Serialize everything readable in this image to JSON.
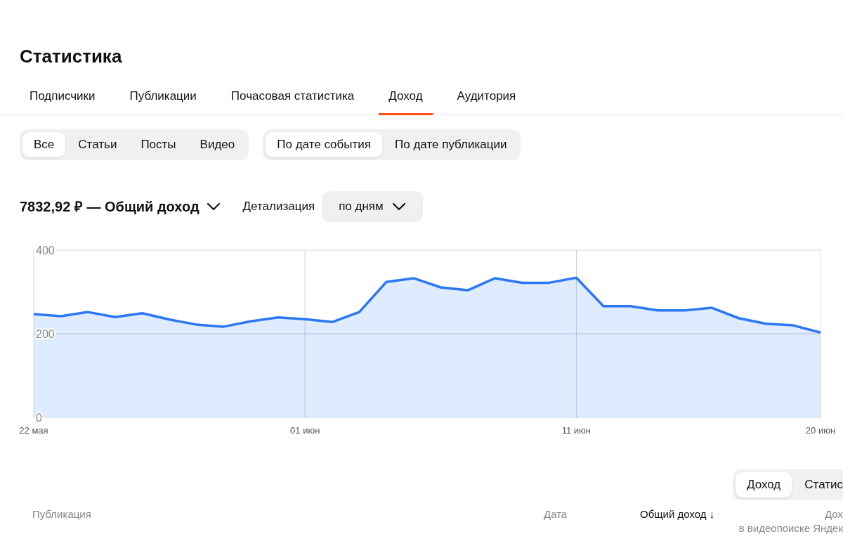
{
  "title": "Статистика",
  "tabs": [
    {
      "label": "Подписчики",
      "selected": false
    },
    {
      "label": "Публикации",
      "selected": false
    },
    {
      "label": "Почасовая статистика",
      "selected": false
    },
    {
      "label": "Доход",
      "selected": true
    },
    {
      "label": "Аудитория",
      "selected": false
    }
  ],
  "content_filter": [
    {
      "label": "Все",
      "selected": true
    },
    {
      "label": "Статьи",
      "selected": false
    },
    {
      "label": "Посты",
      "selected": false
    },
    {
      "label": "Видео",
      "selected": false
    }
  ],
  "date_filter": [
    {
      "label": "По дате события",
      "selected": true
    },
    {
      "label": "По дате публикации",
      "selected": false
    }
  ],
  "summary": {
    "metric": "7832,92 ₽ — Общий доход",
    "detail_label": "Детализация",
    "detail_value": "по дням"
  },
  "chart_data": {
    "type": "area",
    "categories": [
      "22 мая",
      null,
      null,
      null,
      null,
      null,
      null,
      null,
      null,
      null,
      "01 июн",
      null,
      null,
      null,
      null,
      null,
      null,
      null,
      null,
      null,
      "11 июн",
      null,
      null,
      null,
      null,
      null,
      null,
      null,
      null,
      "20 июн"
    ],
    "series": [
      {
        "color": "#2a78f5",
        "values": [
          247,
          242,
          252,
          240,
          249,
          234,
          222,
          217,
          230,
          239,
          235,
          228,
          252,
          324,
          333,
          311,
          304,
          333,
          322,
          322,
          334,
          266,
          266,
          256,
          256,
          262,
          237,
          224,
          220,
          203
        ]
      }
    ],
    "ylim": [
      0,
      400
    ],
    "yticks": [
      0,
      200,
      400
    ],
    "grid": true
  },
  "table_switch": [
    {
      "label": "Доход",
      "selected": true
    },
    {
      "label": "Статис",
      "selected": false
    }
  ],
  "table_columns": [
    {
      "label": "Публикация",
      "sorted": false
    },
    {
      "label": "Дата",
      "sorted": false
    },
    {
      "label": "Общий доход ↓",
      "sorted": true
    },
    {
      "label": "Дох",
      "sublabel": "в видеопоиске Яндек",
      "sorted": false
    }
  ]
}
